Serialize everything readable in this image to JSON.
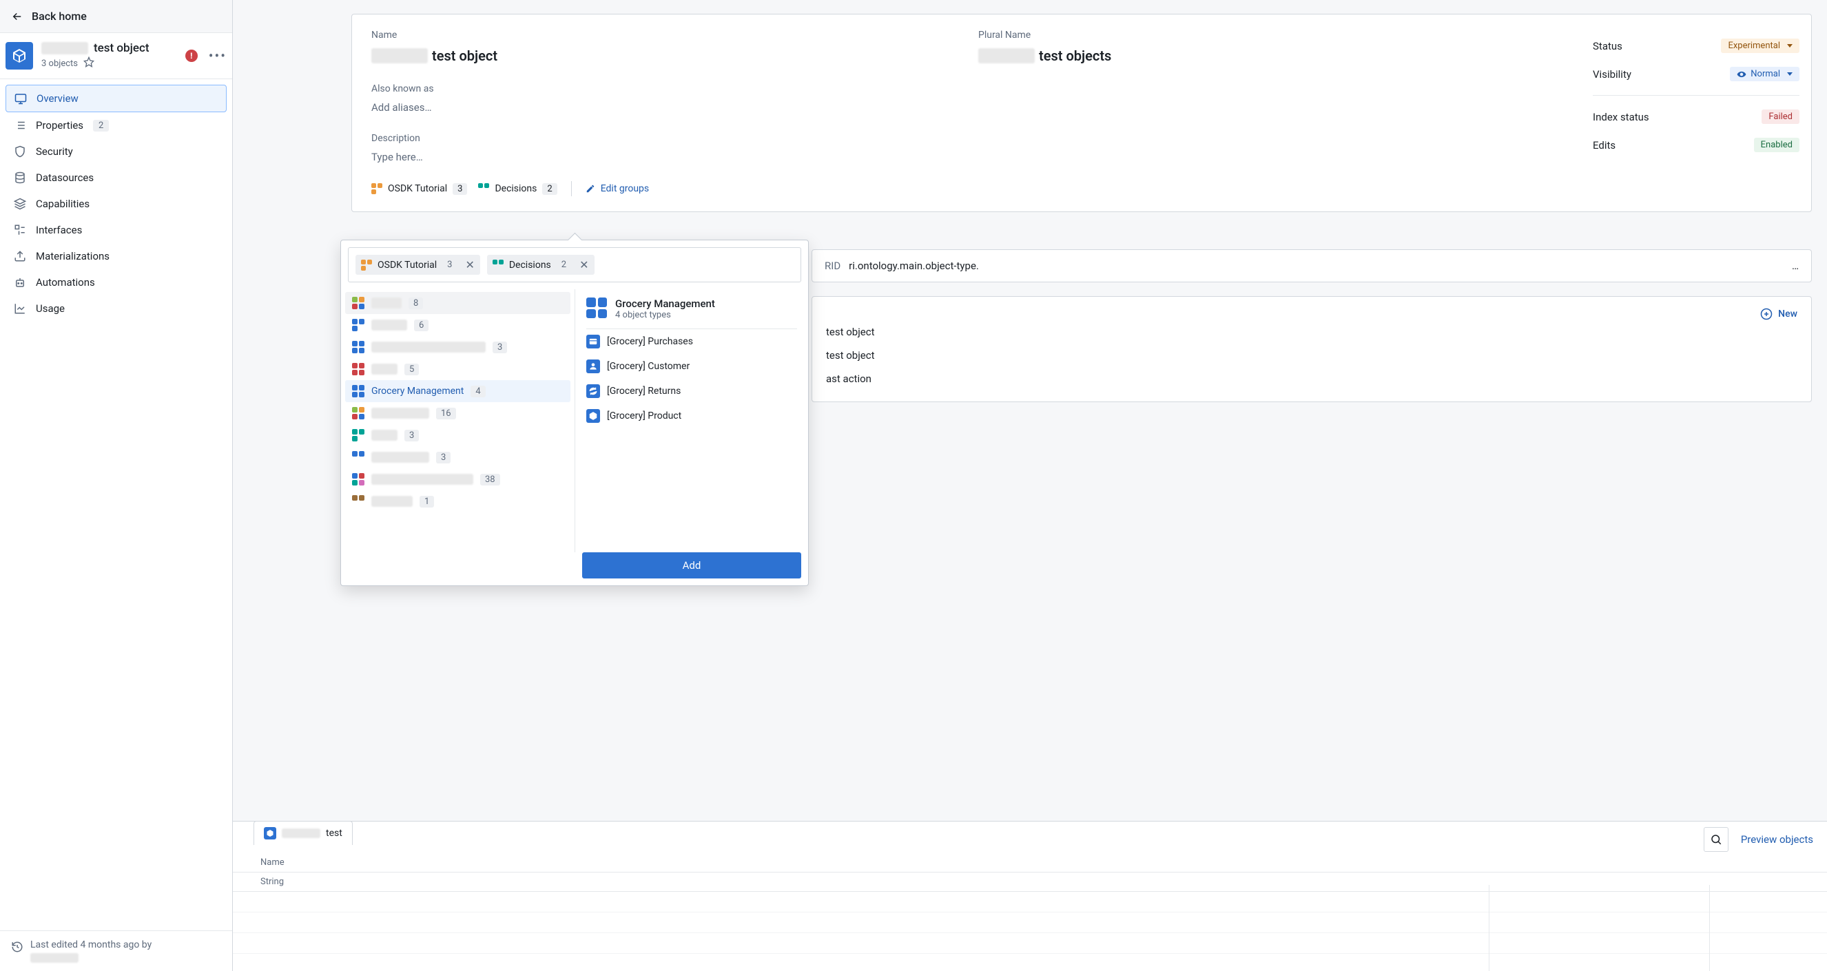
{
  "back": "Back home",
  "object": {
    "title_suffix": "test object",
    "subtitle": "3 objects"
  },
  "nav": {
    "overview": "Overview",
    "properties": "Properties",
    "properties_count": "2",
    "security": "Security",
    "datasources": "Datasources",
    "capabilities": "Capabilities",
    "interfaces": "Interfaces",
    "materializations": "Materializations",
    "automations": "Automations",
    "usage": "Usage"
  },
  "last_edited": "Last edited 4 months ago by",
  "fields": {
    "name_label": "Name",
    "name_suffix": "test object",
    "plural_label": "Plural Name",
    "plural_suffix": "test objects",
    "aka_label": "Also known as",
    "aka_placeholder": "Add aliases…",
    "desc_label": "Description",
    "desc_placeholder": "Type here…"
  },
  "groups": {
    "g1": {
      "name": "OSDK Tutorial",
      "count": "3"
    },
    "g2": {
      "name": "Decisions",
      "count": "2"
    },
    "edit": "Edit groups"
  },
  "status": {
    "status_label": "Status",
    "status_val": "Experimental",
    "vis_label": "Visibility",
    "vis_val": "Normal",
    "index_label": "Index status",
    "index_val": "Failed",
    "edits_label": "Edits",
    "edits_val": "Enabled"
  },
  "rid": {
    "label": "RID",
    "value": "ri.ontology.main.object-type.",
    "ellipsis": "…"
  },
  "actions": {
    "new": "New",
    "a1": "test object",
    "a2": "test object",
    "a3": "ast action"
  },
  "bottom": {
    "tab_suffix": "test",
    "col_name": "Name",
    "col_type": "String",
    "preview": "Preview objects"
  },
  "popover": {
    "chips": {
      "c1": "OSDK Tutorial",
      "c1_count": "3",
      "c2": "Decisions",
      "c2_count": "2"
    },
    "list": [
      {
        "count": "8",
        "w": 44
      },
      {
        "count": "6",
        "w": 52
      },
      {
        "count": "3",
        "w": 166
      },
      {
        "count": "5",
        "w": 38
      },
      {
        "name": "Grocery Management",
        "count": "4",
        "selected": true
      },
      {
        "count": "16",
        "w": 84
      },
      {
        "count": "3",
        "w": 38
      },
      {
        "count": "3",
        "w": 84
      },
      {
        "count": "38",
        "w": 148
      },
      {
        "count": "1",
        "w": 60
      }
    ],
    "detail": {
      "title": "Grocery Management",
      "sub": "4 object types",
      "i1": "[Grocery] Purchases",
      "i2": "[Grocery] Customer",
      "i3": "[Grocery] Returns",
      "i4": "[Grocery] Product"
    },
    "add": "Add"
  }
}
